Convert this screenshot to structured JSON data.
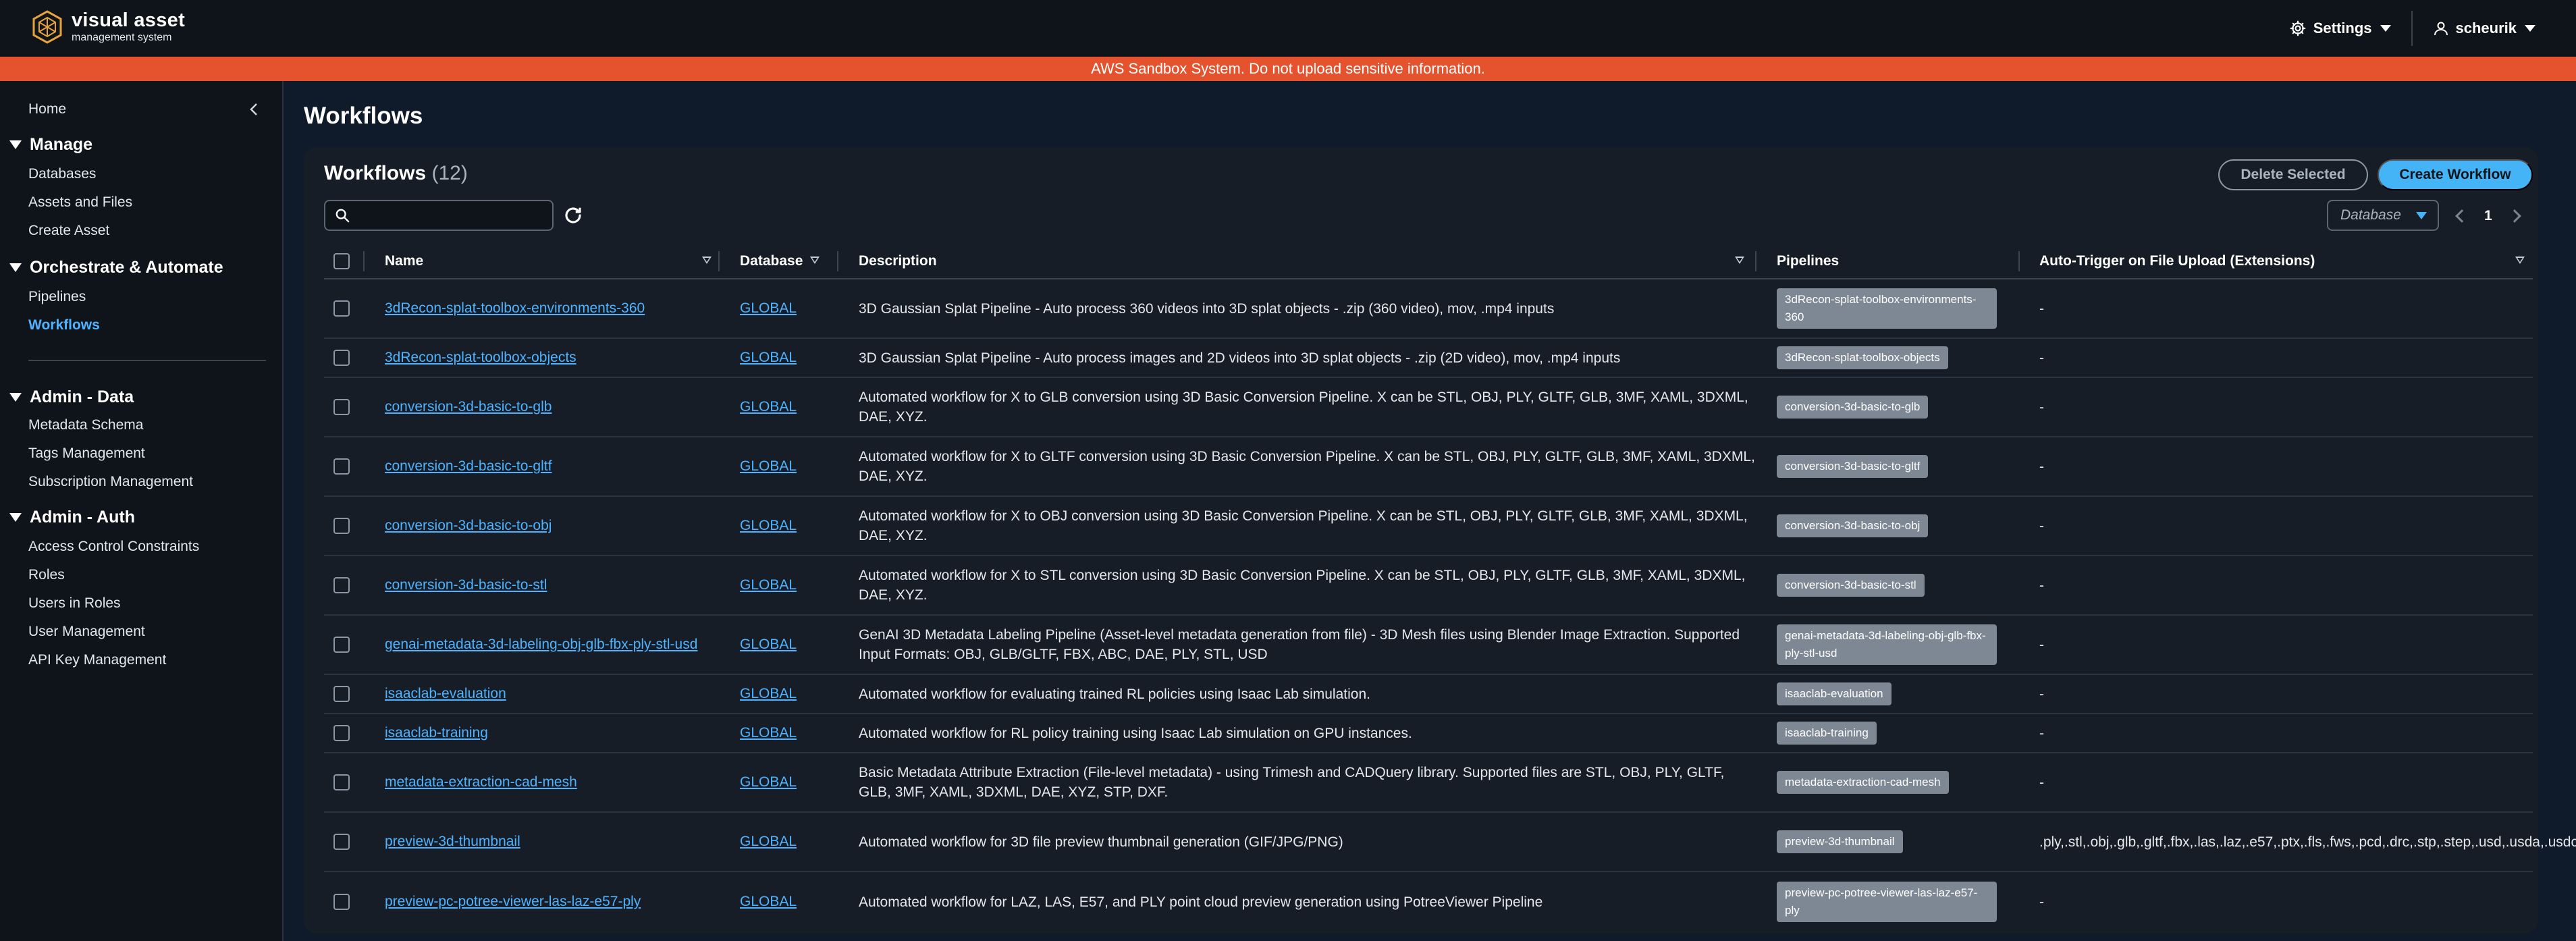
{
  "header": {
    "brand_name": "visual asset",
    "brand_sub": "management system",
    "settings_label": "Settings",
    "user_label": "scheurik"
  },
  "banner": {
    "text": "AWS Sandbox System. Do not upload sensitive information."
  },
  "sidebar": {
    "home": "Home",
    "sections": [
      {
        "label": "Manage",
        "items": [
          "Databases",
          "Assets and Files",
          "Create Asset"
        ]
      },
      {
        "label": "Orchestrate & Automate",
        "items": [
          "Pipelines",
          "Workflows"
        ]
      },
      {
        "label": "Admin - Data",
        "items": [
          "Metadata Schema",
          "Tags Management",
          "Subscription Management"
        ]
      },
      {
        "label": "Admin - Auth",
        "items": [
          "Access Control Constraints",
          "Roles",
          "Users in Roles",
          "User Management",
          "API Key Management"
        ]
      }
    ],
    "active_item": "Workflows"
  },
  "page": {
    "title": "Workflows"
  },
  "table_header": {
    "title": "Workflows",
    "count": "(12)",
    "delete_label": "Delete Selected",
    "create_label": "Create Workflow",
    "search_placeholder": "",
    "db_filter_label": "Database",
    "page_number": "1"
  },
  "columns": {
    "name": "Name",
    "database": "Database",
    "description": "Description",
    "pipelines": "Pipelines",
    "auto_trigger": "Auto-Trigger on File Upload (Extensions)"
  },
  "rows": [
    {
      "name": "3dRecon-splat-toolbox-environments-360",
      "database": "GLOBAL",
      "description": "3D Gaussian Splat Pipeline - Auto process 360 videos into 3D splat objects - .zip (360 video), mov, .mp4 inputs",
      "pipeline": "3dRecon-splat-toolbox-environments-360",
      "auto": "-"
    },
    {
      "name": "3dRecon-splat-toolbox-objects",
      "database": "GLOBAL",
      "description": "3D Gaussian Splat Pipeline - Auto process images and 2D videos into 3D splat objects - .zip (2D video), mov, .mp4 inputs",
      "pipeline": "3dRecon-splat-toolbox-objects",
      "auto": "-"
    },
    {
      "name": "conversion-3d-basic-to-glb",
      "database": "GLOBAL",
      "description": "Automated workflow for X to GLB conversion using 3D Basic Conversion Pipeline. X can be STL, OBJ, PLY, GLTF, GLB, 3MF, XAML, 3DXML, DAE, XYZ.",
      "pipeline": "conversion-3d-basic-to-glb",
      "auto": "-"
    },
    {
      "name": "conversion-3d-basic-to-gltf",
      "database": "GLOBAL",
      "description": "Automated workflow for X to GLTF conversion using 3D Basic Conversion Pipeline. X can be STL, OBJ, PLY, GLTF, GLB, 3MF, XAML, 3DXML, DAE, XYZ.",
      "pipeline": "conversion-3d-basic-to-gltf",
      "auto": "-"
    },
    {
      "name": "conversion-3d-basic-to-obj",
      "database": "GLOBAL",
      "description": "Automated workflow for X to OBJ conversion using 3D Basic Conversion Pipeline. X can be STL, OBJ, PLY, GLTF, GLB, 3MF, XAML, 3DXML, DAE, XYZ.",
      "pipeline": "conversion-3d-basic-to-obj",
      "auto": "-"
    },
    {
      "name": "conversion-3d-basic-to-stl",
      "database": "GLOBAL",
      "description": "Automated workflow for X to STL conversion using 3D Basic Conversion Pipeline. X can be STL, OBJ, PLY, GLTF, GLB, 3MF, XAML, 3DXML, DAE, XYZ.",
      "pipeline": "conversion-3d-basic-to-stl",
      "auto": "-"
    },
    {
      "name": "genai-metadata-3d-labeling-obj-glb-fbx-ply-stl-usd",
      "database": "GLOBAL",
      "description": "GenAI 3D Metadata Labeling Pipeline (Asset-level metadata generation from file) - 3D Mesh files using Blender Image Extraction. Supported Input Formats: OBJ, GLB/GLTF, FBX, ABC, DAE, PLY, STL, USD",
      "pipeline": "genai-metadata-3d-labeling-obj-glb-fbx-ply-stl-usd",
      "auto": "-"
    },
    {
      "name": "isaaclab-evaluation",
      "database": "GLOBAL",
      "description": "Automated workflow for evaluating trained RL policies using Isaac Lab simulation.",
      "pipeline": "isaaclab-evaluation",
      "auto": "-"
    },
    {
      "name": "isaaclab-training",
      "database": "GLOBAL",
      "description": "Automated workflow for RL policy training using Isaac Lab simulation on GPU instances.",
      "pipeline": "isaaclab-training",
      "auto": "-"
    },
    {
      "name": "metadata-extraction-cad-mesh",
      "database": "GLOBAL",
      "description": "Basic Metadata Attribute Extraction (File-level metadata) - using Trimesh and CADQuery library. Supported files are STL, OBJ, PLY, GLTF, GLB, 3MF, XAML, 3DXML, DAE, XYZ, STP, DXF.",
      "pipeline": "metadata-extraction-cad-mesh",
      "auto": "-"
    },
    {
      "name": "preview-3d-thumbnail",
      "database": "GLOBAL",
      "description": "Automated workflow for 3D file preview thumbnail generation (GIF/JPG/PNG)",
      "pipeline": "preview-3d-thumbnail",
      "auto": ".ply,.stl,.obj,.glb,.gltf,.fbx,.las,.laz,.e57,.ptx,.fls,.fws,.pcd,.drc,.stp,.step,.usd,.usda,.usdc,.usdz"
    },
    {
      "name": "preview-pc-potree-viewer-las-laz-e57-ply",
      "database": "GLOBAL",
      "description": "Automated workflow for LAZ, LAS, E57, and PLY point cloud preview generation using PotreeViewer Pipeline",
      "pipeline": "preview-pc-potree-viewer-las-laz-e57-ply",
      "auto": "-"
    }
  ],
  "colors": {
    "accent": "#44b4f7",
    "banner": "#e5532e",
    "link": "#4fb3ff",
    "chip": "#7e8894"
  }
}
